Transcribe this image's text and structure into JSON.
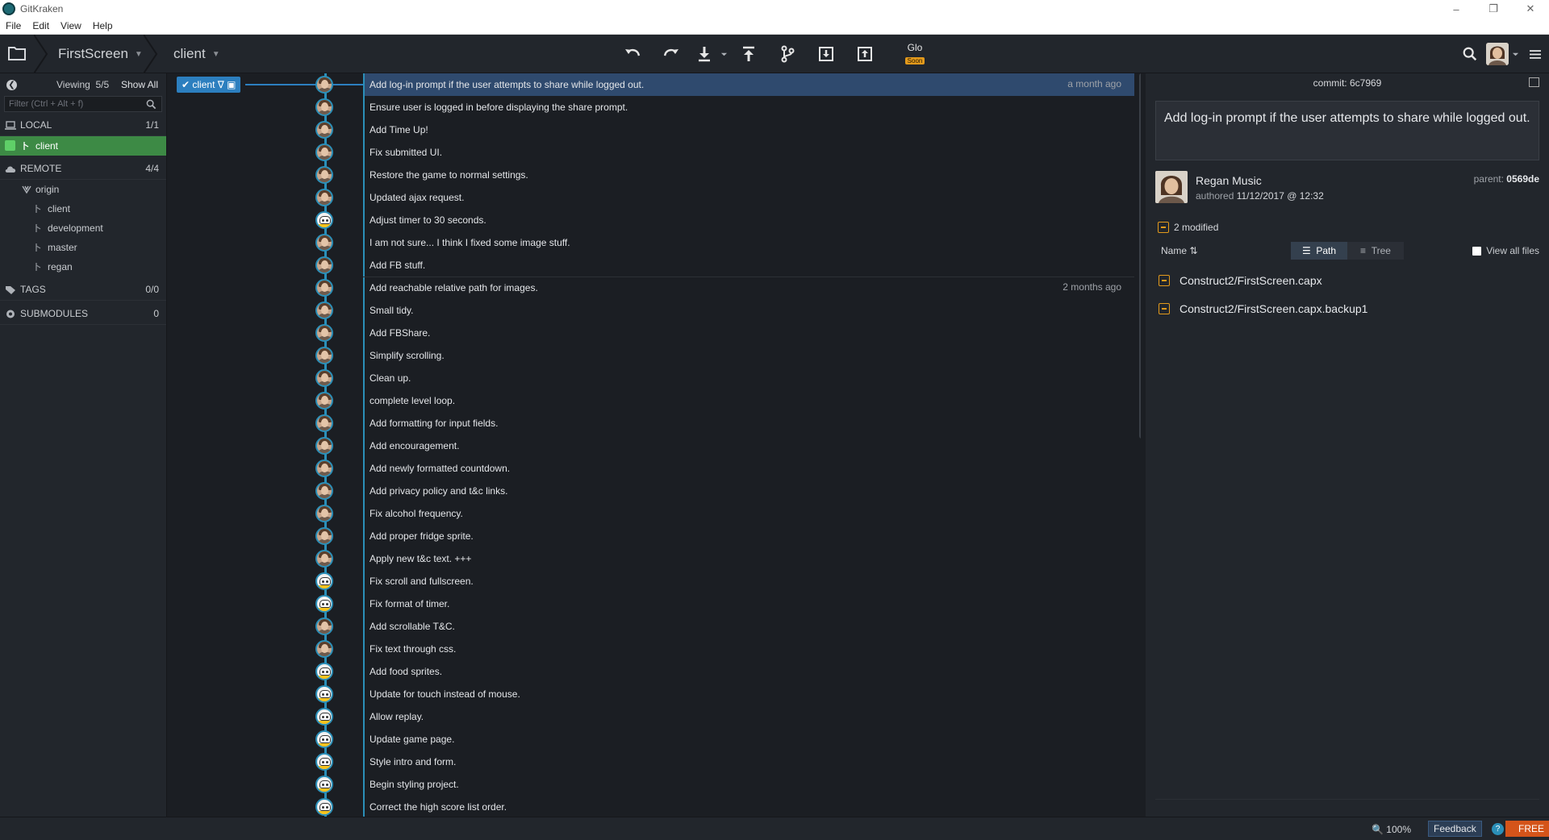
{
  "window": {
    "title": "GitKraken"
  },
  "menu": [
    "File",
    "Edit",
    "View",
    "Help"
  ],
  "toolbar": {
    "repo": "FirstScreen",
    "branch": "client",
    "glo_label": "Glo",
    "glo_badge": "Soon"
  },
  "sidebar": {
    "viewing": "Viewing",
    "viewing_count": "5/5",
    "show_all": "Show All",
    "filter_placeholder": "Filter (Ctrl + Alt + f)",
    "local_label": "LOCAL",
    "local_count": "1/1",
    "local_branch": "client",
    "remote_label": "REMOTE",
    "remote_count": "4/4",
    "remote_name": "origin",
    "remote_branches": [
      "client",
      "development",
      "master",
      "regan"
    ],
    "tags_label": "TAGS",
    "tags_count": "0/0",
    "submodules_label": "SUBMODULES",
    "submodules_count": "0"
  },
  "graph": {
    "branch_tag": "client",
    "commits": [
      {
        "msg": "Add log-in prompt if the user attempts to share while logged out.",
        "date": "a month ago",
        "avatar": "regan",
        "selected": true
      },
      {
        "msg": "Ensure user is logged in before displaying the share prompt.",
        "date": "",
        "avatar": "regan"
      },
      {
        "msg": "Add Time Up!",
        "date": "",
        "avatar": "regan"
      },
      {
        "msg": "Fix submitted UI.",
        "date": "",
        "avatar": "regan"
      },
      {
        "msg": "Restore the game to normal settings.",
        "date": "",
        "avatar": "regan"
      },
      {
        "msg": "Updated ajax request.",
        "date": "",
        "avatar": "regan"
      },
      {
        "msg": "Adjust timer to 30 seconds.",
        "date": "",
        "avatar": "bot"
      },
      {
        "msg": "I am not sure... I think I fixed some image stuff.",
        "date": "",
        "avatar": "regan"
      },
      {
        "msg": "Add FB stuff.",
        "date": "",
        "avatar": "regan"
      },
      {
        "msg": "Add reachable relative path for images.",
        "date": "2 months ago",
        "avatar": "regan",
        "divider": true
      },
      {
        "msg": "Small tidy.",
        "date": "",
        "avatar": "regan"
      },
      {
        "msg": "Add FBShare.",
        "date": "",
        "avatar": "regan"
      },
      {
        "msg": "Simplify scrolling.",
        "date": "",
        "avatar": "regan"
      },
      {
        "msg": "Clean up.",
        "date": "",
        "avatar": "regan"
      },
      {
        "msg": "complete level loop.",
        "date": "",
        "avatar": "regan"
      },
      {
        "msg": "Add formatting for input fields.",
        "date": "",
        "avatar": "regan"
      },
      {
        "msg": "Add encouragement.",
        "date": "",
        "avatar": "regan"
      },
      {
        "msg": "Add newly formatted countdown.",
        "date": "",
        "avatar": "regan"
      },
      {
        "msg": "Add privacy policy and t&c links.",
        "date": "",
        "avatar": "regan"
      },
      {
        "msg": "Fix alcohol frequency.",
        "date": "",
        "avatar": "regan"
      },
      {
        "msg": "Add proper fridge sprite.",
        "date": "",
        "avatar": "regan"
      },
      {
        "msg": "Apply new t&c text. +++",
        "date": "",
        "avatar": "regan"
      },
      {
        "msg": "Fix scroll and fullscreen.",
        "date": "",
        "avatar": "bot"
      },
      {
        "msg": "Fix format of timer.",
        "date": "",
        "avatar": "bot"
      },
      {
        "msg": "Add scrollable T&C.",
        "date": "",
        "avatar": "regan"
      },
      {
        "msg": "Fix text through css.",
        "date": "",
        "avatar": "regan"
      },
      {
        "msg": "Add food sprites.",
        "date": "",
        "avatar": "bot"
      },
      {
        "msg": "Update for touch instead of mouse.",
        "date": "",
        "avatar": "bot"
      },
      {
        "msg": "Allow replay.",
        "date": "",
        "avatar": "bot"
      },
      {
        "msg": "Update game page.",
        "date": "",
        "avatar": "bot"
      },
      {
        "msg": "Style intro and form.",
        "date": "",
        "avatar": "bot"
      },
      {
        "msg": "Begin styling project.",
        "date": "",
        "avatar": "bot"
      },
      {
        "msg": "Correct the high score list order.",
        "date": "",
        "avatar": "bot"
      }
    ]
  },
  "details": {
    "commit_label": "commit:",
    "commit_sha": "6c7969",
    "summary": "Add log-in prompt if the user attempts to share while logged out.",
    "author": "Regan Music",
    "authored_label": "authored",
    "authored_date": "11/12/2017 @ 12:32",
    "parent_label": "parent:",
    "parent_sha": "0569de",
    "modified": "2 modified",
    "name_col": "Name",
    "path_btn": "Path",
    "tree_btn": "Tree",
    "view_all": "View all files",
    "files": [
      "Construct2/FirstScreen.capx",
      "Construct2/FirstScreen.capx.backup1"
    ]
  },
  "status": {
    "zoom": "100%",
    "feedback": "Feedback",
    "help": "?",
    "free": "FREE"
  }
}
